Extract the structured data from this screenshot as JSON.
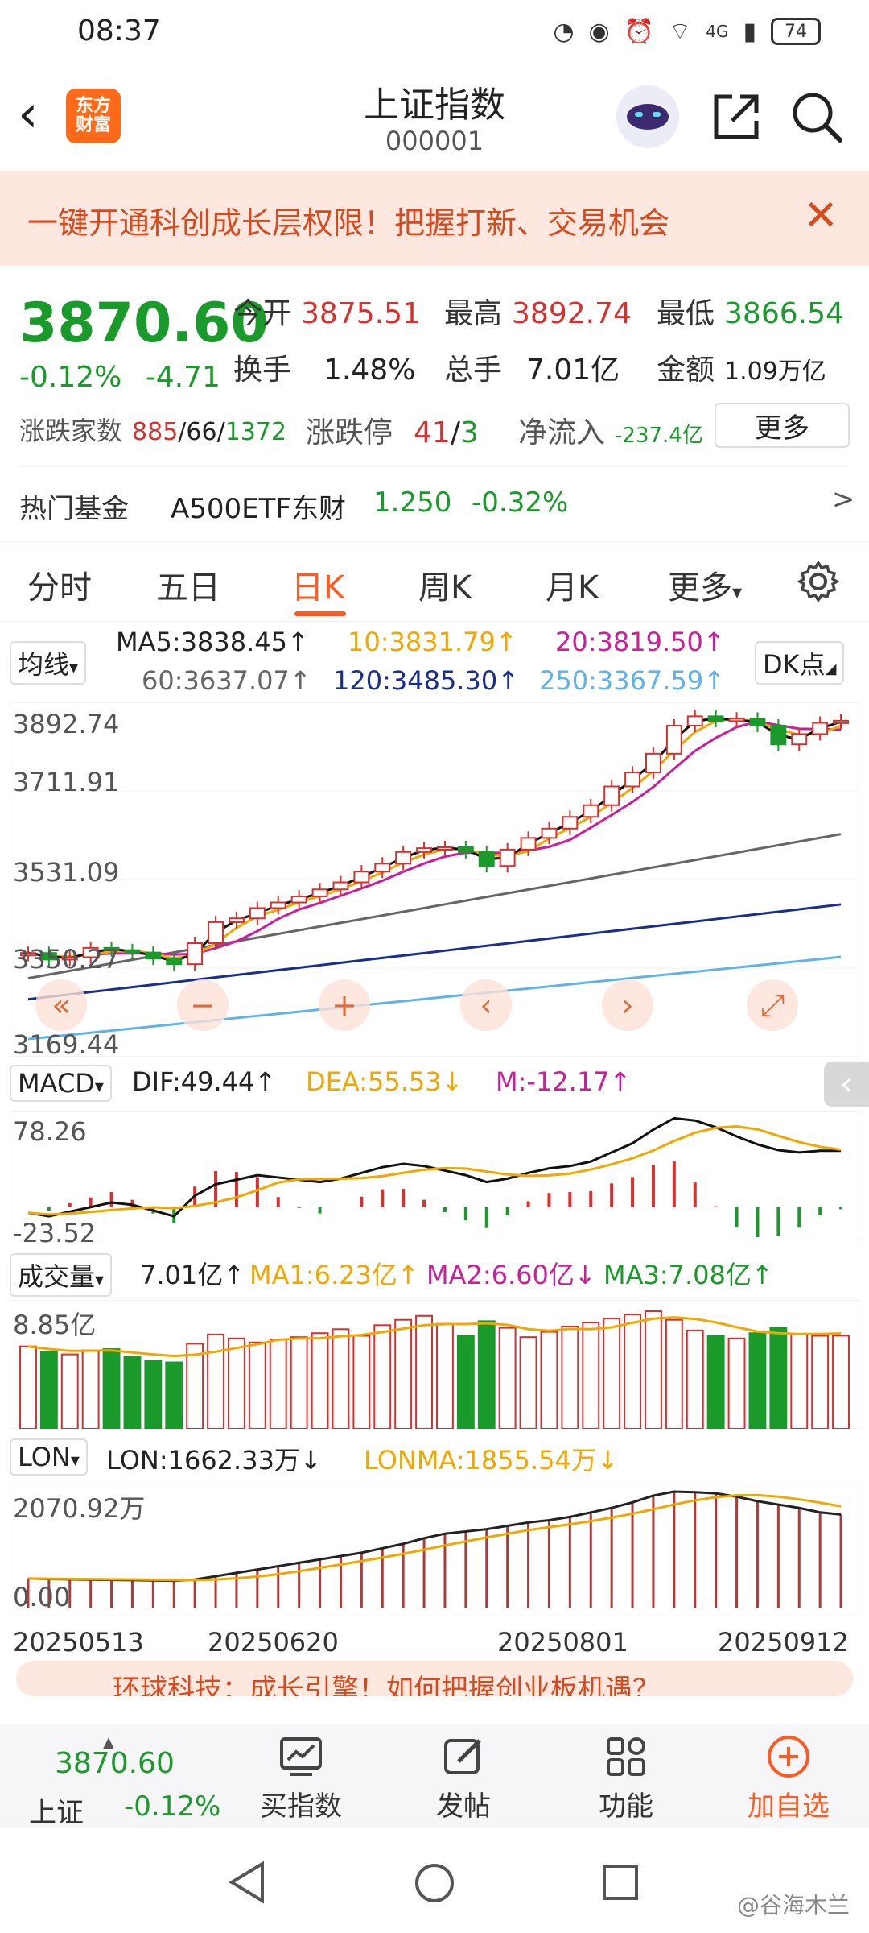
{
  "status": {
    "time": "08:37",
    "network": "4G",
    "battery": "74"
  },
  "header": {
    "back_icon": "chevron-left-icon",
    "logo_text": "东方财富",
    "title": "上证指数",
    "code": "000001"
  },
  "banner": {
    "text": "一键开通科创成长层权限！把握打新、交易机会",
    "close": "✕"
  },
  "quote": {
    "price": "3870.60",
    "change_pct": "-0.12%",
    "change_abs": "-4.71",
    "open_label": "今开",
    "open": "3875.51",
    "high_label": "最高",
    "high": "3892.74",
    "low_label": "最低",
    "low": "3866.54",
    "turnover_label": "换手",
    "turnover": "1.48%",
    "volume_label": "总手",
    "volume": "7.01亿",
    "amount_label": "金额",
    "amount": "1.09万亿",
    "breadth_label": "涨跌家数",
    "breadth_up": "885",
    "breadth_flat": "66",
    "breadth_down": "1372",
    "sep": "/",
    "limit_label": "涨跌停",
    "limit_up": "41",
    "limit_down": "3",
    "inflow_label": "净流入",
    "inflow": "-237.4亿",
    "more_btn": "更多"
  },
  "fund": {
    "label": "热门基金",
    "name": "A500ETF东财",
    "price": "1.250",
    "change": "-0.32%",
    "arrow": ">"
  },
  "tabs": [
    {
      "label": "分时"
    },
    {
      "label": "五日"
    },
    {
      "label": "日K"
    },
    {
      "label": "周K"
    },
    {
      "label": "月K"
    },
    {
      "label": "更多"
    }
  ],
  "tabs_more_caret": "▾",
  "ma_legend": {
    "selector": "均线",
    "caret": "▾",
    "ma5": "MA5:3838.45↑",
    "ma10": "10:3831.79↑",
    "ma20": "20:3819.50↑",
    "ma60": "60:3637.07↑",
    "ma120": "120:3485.30↑",
    "ma250": "250:3367.59↑",
    "dk": "DK点"
  },
  "price_axis": {
    "p1": "3892.74",
    "p2": "3711.91",
    "p3": "3531.09",
    "p4": "3350.27",
    "p5": "3169.44"
  },
  "toolbar": {
    "b1": "«",
    "b2": "−",
    "b3": "+",
    "b4": "‹",
    "b5": "›",
    "b6": "⤢"
  },
  "macd": {
    "selector": "MACD",
    "caret": "▾",
    "dif": "DIF:49.44↑",
    "dea": "DEA:55.53↓",
    "m": "M:-12.17↑",
    "top": "78.26",
    "bottom": "-23.52"
  },
  "vol": {
    "selector": "成交量",
    "caret": "▾",
    "val": "7.01亿↑",
    "ma1": "MA1:6.23亿↑",
    "ma2": "MA2:6.60亿↓",
    "ma3": "MA3:7.08亿↑",
    "top": "8.85亿"
  },
  "lon": {
    "selector": "LON",
    "caret": "▾",
    "lon": "LON:1662.33万↓",
    "lonma": "LONMA:1855.54万↓",
    "top": "2070.92万",
    "bottom": "0.00"
  },
  "dates": [
    "20250513",
    "20250620",
    "20250801",
    "20250912"
  ],
  "colors": {
    "up": "#d8302f",
    "down": "#1b9a2c",
    "accent": "#ff5a1f",
    "ma5": "#111111",
    "ma10": "#f0a800",
    "ma20": "#cc1e9a",
    "ma60": "#666666",
    "ma120": "#1a2e8c",
    "ma250": "#5fb3e6"
  },
  "chart_data": {
    "type": "candlestick",
    "ylim": [
      3169.44,
      3892.74
    ],
    "x": [
      "20250513",
      "20250620",
      "20250801",
      "20250912"
    ],
    "price_points": [
      3374,
      3360,
      3365,
      3385,
      3380,
      3375,
      3362,
      3350,
      3395,
      3440,
      3448,
      3470,
      3482,
      3495,
      3510,
      3525,
      3548,
      3565,
      3590,
      3598,
      3600,
      3590,
      3560,
      3595,
      3620,
      3640,
      3665,
      3690,
      3730,
      3760,
      3800,
      3860,
      3880,
      3870,
      3875,
      3860,
      3820,
      3842,
      3866,
      3870.6
    ],
    "macd_dif": [
      -5,
      -8,
      -4,
      0,
      4,
      2,
      -3,
      -8,
      10,
      20,
      24,
      28,
      26,
      24,
      22,
      25,
      30,
      35,
      38,
      36,
      32,
      28,
      22,
      25,
      30,
      34,
      36,
      40,
      48,
      56,
      68,
      78,
      76,
      70,
      62,
      55,
      50,
      48,
      49.44,
      49.44
    ],
    "volume_yi": [
      6.2,
      5.8,
      5.6,
      5.9,
      6.0,
      5.4,
      5.1,
      5.0,
      6.4,
      7.1,
      6.8,
      6.5,
      6.7,
      6.9,
      7.2,
      7.5,
      7.0,
      7.8,
      8.2,
      8.5,
      7.9,
      7.0,
      8.1,
      7.6,
      6.9,
      7.3,
      7.7,
      8.0,
      8.3,
      8.6,
      8.85,
      8.2,
      7.4,
      7.0,
      6.8,
      7.2,
      7.6,
      7.1,
      7.0,
      7.01
    ],
    "lon_wan": [
      520,
      510,
      505,
      500,
      495,
      490,
      485,
      480,
      500,
      560,
      620,
      680,
      740,
      800,
      860,
      920,
      980,
      1060,
      1140,
      1240,
      1320,
      1360,
      1400,
      1460,
      1520,
      1560,
      1620,
      1700,
      1780,
      1880,
      2000,
      2070.92,
      2060,
      2040,
      1980,
      1900,
      1840,
      1780,
      1700,
      1662.33
    ]
  },
  "news": {
    "text": "环球科技：成长引擎！如何把握创业板机遇？"
  },
  "bottom": {
    "idx_price": "3870.60",
    "idx_name": "上证",
    "idx_change": "-0.12%",
    "buy": "买指数",
    "post": "发帖",
    "func": "功能",
    "add": "加自选"
  },
  "watermark": "@谷海木兰"
}
